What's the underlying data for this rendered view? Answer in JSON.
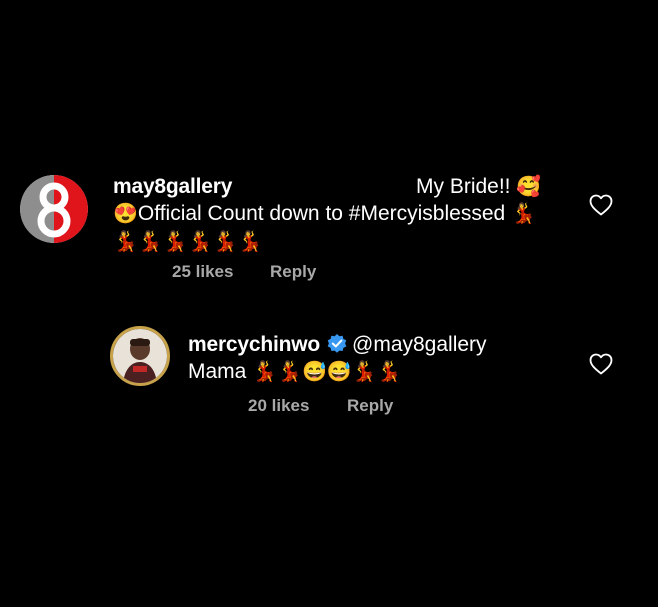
{
  "comments": [
    {
      "username": "may8gallery",
      "line1_suffix": "My Bride!!",
      "line1_emoji": "🥰",
      "line2_lead_emoji": "😍",
      "line2_text": "Official Count down  to #Mercyisblessed",
      "line2_trail_emoji": "💃",
      "line3_emojis": "💃💃💃💃💃💃",
      "likes": "25 likes",
      "reply_label": "Reply"
    },
    {
      "username": "mercychinwo",
      "mention": "@may8gallery",
      "text": "Mama",
      "emojis": "💃💃😅😅💃💃",
      "likes": "20 likes",
      "reply_label": "Reply"
    }
  ],
  "icons": {
    "like": "heart-outline-icon",
    "verified": "verified-badge-icon"
  },
  "colors": {
    "background": "#000000",
    "secondary_text": "#a8a8a8",
    "verified_blue": "#3897f0",
    "avatar_ring": "#c7a24a"
  }
}
